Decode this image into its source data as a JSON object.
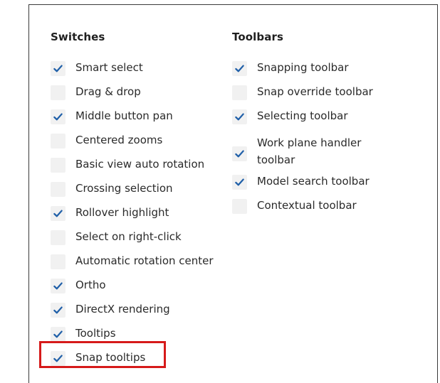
{
  "switches": {
    "heading": "Switches",
    "items": [
      {
        "label": "Smart select",
        "checked": true
      },
      {
        "label": "Drag & drop",
        "checked": false
      },
      {
        "label": "Middle button pan",
        "checked": true
      },
      {
        "label": "Centered zooms",
        "checked": false
      },
      {
        "label": "Basic view auto rotation",
        "checked": false
      },
      {
        "label": "Crossing selection",
        "checked": false
      },
      {
        "label": "Rollover highlight",
        "checked": true
      },
      {
        "label": "Select on right-click",
        "checked": false
      },
      {
        "label": "Automatic rotation center",
        "checked": false
      },
      {
        "label": "Ortho",
        "checked": true
      },
      {
        "label": "DirectX rendering",
        "checked": true
      },
      {
        "label": "Tooltips",
        "checked": true
      },
      {
        "label": "Snap tooltips",
        "checked": true
      }
    ]
  },
  "toolbars": {
    "heading": "Toolbars",
    "items": [
      {
        "label": "Snapping toolbar",
        "checked": true
      },
      {
        "label": "Snap override toolbar",
        "checked": false
      },
      {
        "label": "Selecting toolbar",
        "checked": true
      },
      {
        "label": "Work plane handler toolbar",
        "checked": true
      },
      {
        "label": "Model search toolbar",
        "checked": true
      },
      {
        "label": "Contextual toolbar",
        "checked": false
      }
    ]
  },
  "colors": {
    "check": "#1f5fa8",
    "highlight": "#d61a1a",
    "box": "#f1f1f1"
  },
  "icons": {
    "checked": "checkmark-icon"
  }
}
